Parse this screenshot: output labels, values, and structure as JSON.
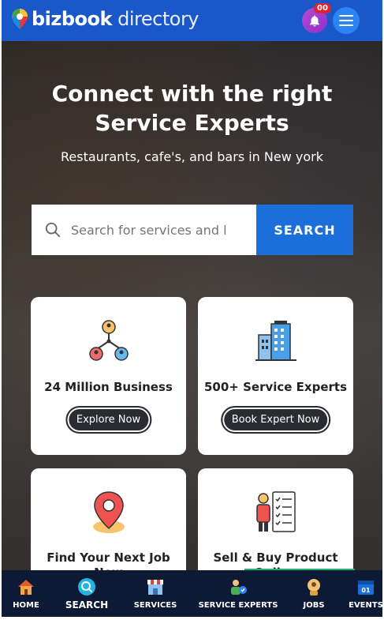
{
  "header": {
    "logo_bold": "bizbook",
    "logo_light": "directory",
    "notification_count": "00",
    "colors": {
      "bar": "#1a57c9",
      "bell": "#9b3bd0",
      "badge": "#e0232e",
      "menu": "#2b84f2"
    }
  },
  "hero": {
    "title_line1": "Connect with the right",
    "title_line2": "Service Experts",
    "subtitle": "Restaurants, cafe's, and bars in New york",
    "search_placeholder": "Search for services and l",
    "search_button": "SEARCH"
  },
  "cards": [
    {
      "title": "24 Million Business",
      "button": "Explore Now",
      "icon": "network-people-icon"
    },
    {
      "title": "500+ Service Experts",
      "button": "Book Expert Now",
      "icon": "buildings-icon"
    },
    {
      "title": "Find Your Next Job",
      "title_overflow": "Now",
      "icon": "location-pin-icon"
    },
    {
      "title": "Sell & Buy Product",
      "title_overflow": "Online",
      "icon": "checklist-person-icon"
    }
  ],
  "bottom_nav": [
    {
      "label": "HOME",
      "icon": "home-icon"
    },
    {
      "label": "SEARCH",
      "icon": "search-icon"
    },
    {
      "label": "SERVICES",
      "icon": "shop-icon"
    },
    {
      "label": "SERVICE EXPERTS",
      "icon": "expert-icon"
    },
    {
      "label": "JOBS",
      "icon": "jobs-icon"
    },
    {
      "label": "EVENTS",
      "icon": "calendar-icon",
      "badge": "01"
    }
  ]
}
